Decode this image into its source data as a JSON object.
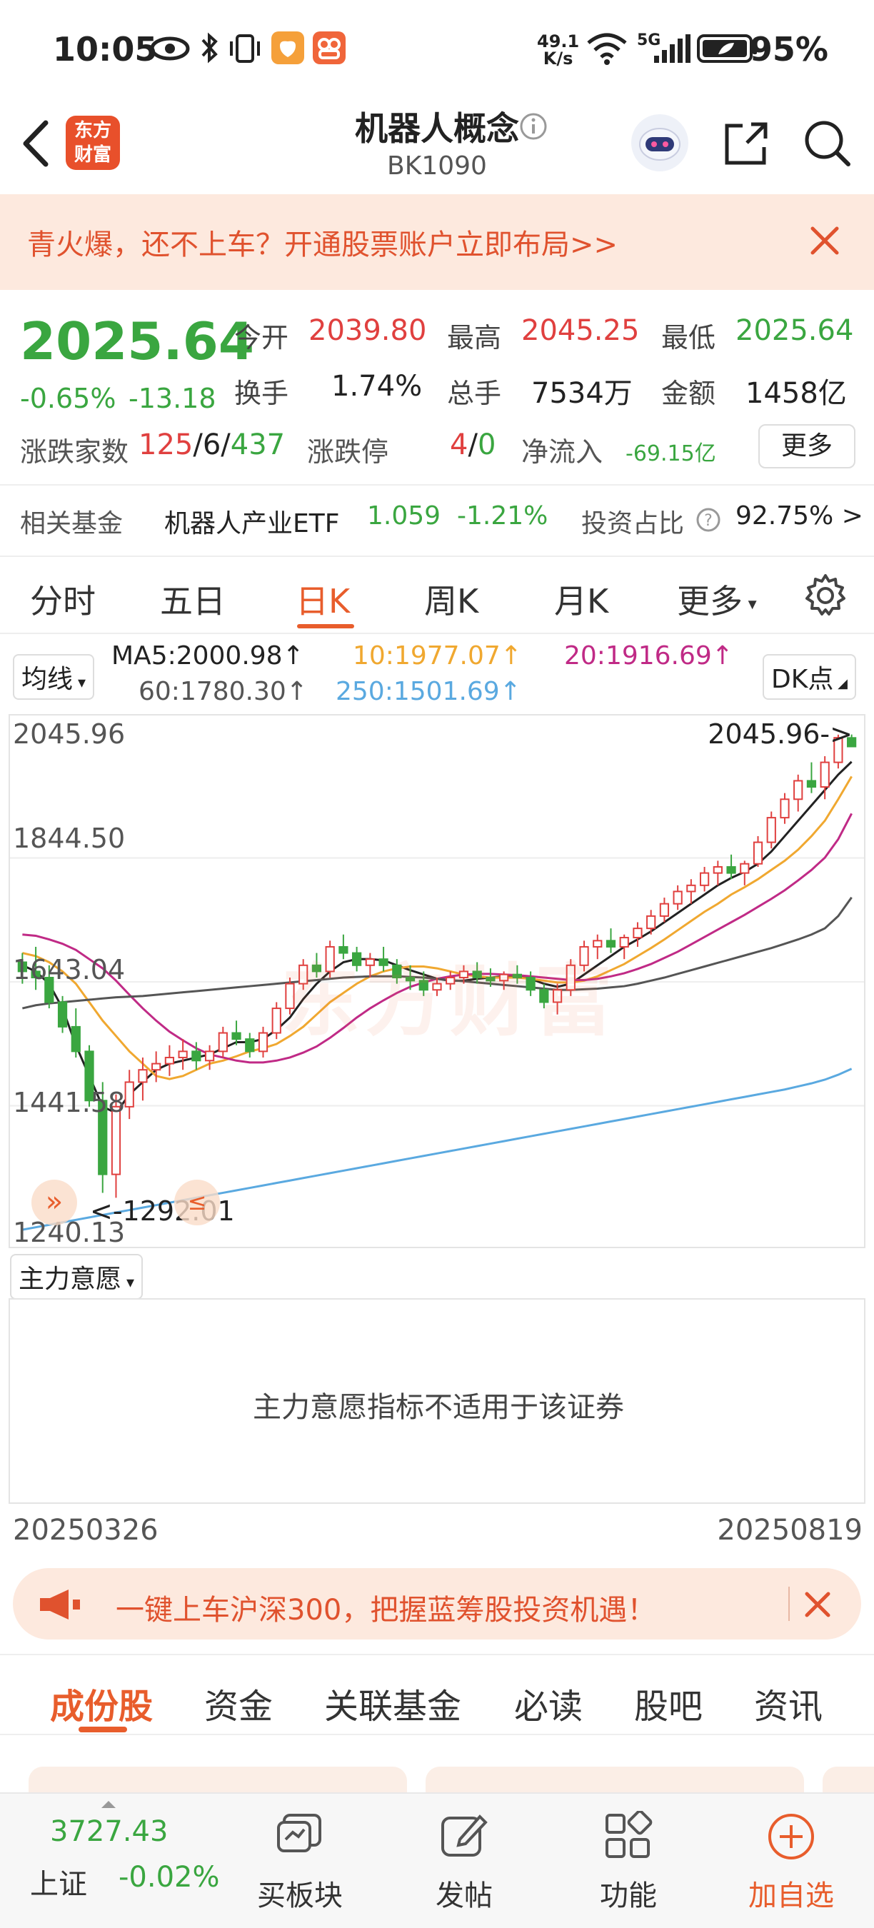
{
  "status_bar": {
    "time": "10:05",
    "net_speed_top": "49.1",
    "net_speed_unit": "K/s",
    "signal": "5G",
    "battery": "95%"
  },
  "header": {
    "title": "机器人概念",
    "code": "BK1090",
    "back_icon": "chevron-left-icon",
    "logo_line1": "东方",
    "logo_line2": "财富"
  },
  "promo": {
    "text": "青火爆，还不上车？开通股票账户立即布局>>"
  },
  "quote": {
    "price": "2025.64",
    "change_pct": "-0.65%",
    "change": "-13.18",
    "open_label": "今开",
    "open": "2039.80",
    "high_label": "最高",
    "high": "2045.25",
    "low_label": "最低",
    "low": "2025.64",
    "turnover_label": "换手",
    "turnover": "1.74%",
    "volume_label": "总手",
    "volume": "7534万",
    "amount_label": "金额",
    "amount": "1458亿",
    "updown_label": "涨跌家数",
    "up_count": "125",
    "flat_count": "6",
    "down_count": "437",
    "limit_label": "涨跌停",
    "limit_up": "4",
    "limit_down": "0",
    "inflow_label": "净流入",
    "inflow": "-69.15亿",
    "more_label": "更多",
    "fund_label": "相关基金",
    "fund_name": "机器人产业ETF",
    "fund_price": "1.059",
    "fund_change": "-1.21%",
    "invest_ratio_label": "投资占比",
    "invest_ratio": "92.75% >"
  },
  "ktabs": [
    "分时",
    "五日",
    "日K",
    "周K",
    "月K",
    "更多"
  ],
  "ktab_active": 2,
  "ma": {
    "selector": "均线",
    "ma5": "MA5:2000.98↑",
    "ma10": "10:1977.07↑",
    "ma20": "20:1916.69↑",
    "ma60": "60:1780.30↑",
    "ma250": "250:1501.69↑",
    "dk": "DK点",
    "colors": {
      "ma5": "#222222",
      "ma10": "#f0a830",
      "ma20": "#c02a86",
      "ma60": "#555555",
      "ma250": "#5aa9e0"
    }
  },
  "chart": {
    "y_labels": [
      "2045.96",
      "1844.50",
      "1643.04",
      "1441.58",
      "1240.13"
    ],
    "high_marker": "2045.96->",
    "low_marker": "<-1292.01",
    "watermark": "东方财富"
  },
  "chart_data": {
    "type": "candlestick",
    "ylim": [
      1240.13,
      2045.96
    ],
    "x_start": "20250326",
    "x_end": "20250819",
    "up_color": "#e0403f",
    "down_color": "#3aa640",
    "ohlc": [
      [
        1675,
        1690,
        1640,
        1660
      ],
      [
        1660,
        1700,
        1630,
        1650
      ],
      [
        1650,
        1670,
        1600,
        1610
      ],
      [
        1610,
        1620,
        1560,
        1570
      ],
      [
        1570,
        1600,
        1520,
        1530
      ],
      [
        1530,
        1540,
        1440,
        1450
      ],
      [
        1450,
        1480,
        1300,
        1330
      ],
      [
        1330,
        1460,
        1292,
        1440
      ],
      [
        1440,
        1500,
        1420,
        1480
      ],
      [
        1480,
        1520,
        1450,
        1500
      ],
      [
        1500,
        1530,
        1480,
        1510
      ],
      [
        1510,
        1540,
        1490,
        1520
      ],
      [
        1520,
        1550,
        1500,
        1530
      ],
      [
        1530,
        1545,
        1500,
        1515
      ],
      [
        1515,
        1540,
        1500,
        1530
      ],
      [
        1530,
        1570,
        1520,
        1560
      ],
      [
        1560,
        1580,
        1540,
        1550
      ],
      [
        1550,
        1560,
        1520,
        1530
      ],
      [
        1530,
        1570,
        1520,
        1560
      ],
      [
        1560,
        1610,
        1550,
        1600
      ],
      [
        1600,
        1650,
        1590,
        1640
      ],
      [
        1640,
        1680,
        1630,
        1670
      ],
      [
        1670,
        1690,
        1650,
        1660
      ],
      [
        1660,
        1710,
        1650,
        1700
      ],
      [
        1700,
        1720,
        1680,
        1690
      ],
      [
        1690,
        1700,
        1660,
        1670
      ],
      [
        1670,
        1690,
        1650,
        1680
      ],
      [
        1680,
        1700,
        1660,
        1670
      ],
      [
        1670,
        1680,
        1640,
        1650
      ],
      [
        1650,
        1670,
        1630,
        1645
      ],
      [
        1645,
        1660,
        1620,
        1630
      ],
      [
        1630,
        1650,
        1620,
        1640
      ],
      [
        1640,
        1660,
        1630,
        1650
      ],
      [
        1650,
        1670,
        1640,
        1660
      ],
      [
        1660,
        1675,
        1640,
        1650
      ],
      [
        1650,
        1665,
        1635,
        1645
      ],
      [
        1645,
        1660,
        1630,
        1655
      ],
      [
        1655,
        1670,
        1640,
        1650
      ],
      [
        1650,
        1660,
        1620,
        1630
      ],
      [
        1630,
        1640,
        1600,
        1610
      ],
      [
        1610,
        1640,
        1590,
        1630
      ],
      [
        1630,
        1680,
        1620,
        1670
      ],
      [
        1670,
        1710,
        1660,
        1700
      ],
      [
        1700,
        1720,
        1680,
        1710
      ],
      [
        1710,
        1730,
        1690,
        1700
      ],
      [
        1700,
        1720,
        1680,
        1715
      ],
      [
        1715,
        1740,
        1700,
        1730
      ],
      [
        1730,
        1760,
        1720,
        1750
      ],
      [
        1750,
        1780,
        1740,
        1770
      ],
      [
        1770,
        1800,
        1760,
        1790
      ],
      [
        1790,
        1810,
        1770,
        1800
      ],
      [
        1800,
        1830,
        1790,
        1820
      ],
      [
        1820,
        1840,
        1800,
        1830
      ],
      [
        1830,
        1850,
        1810,
        1820
      ],
      [
        1820,
        1840,
        1800,
        1835
      ],
      [
        1835,
        1880,
        1830,
        1870
      ],
      [
        1870,
        1920,
        1860,
        1910
      ],
      [
        1910,
        1950,
        1900,
        1940
      ],
      [
        1940,
        1980,
        1920,
        1970
      ],
      [
        1970,
        2000,
        1950,
        1960
      ],
      [
        1960,
        2010,
        1940,
        2000
      ],
      [
        2000,
        2045,
        1990,
        2040
      ],
      [
        2039.8,
        2045.25,
        2025.64,
        2025.64
      ]
    ],
    "ma_lines": {
      "ma5": [
        1670,
        1660,
        1640,
        1600,
        1540,
        1490,
        1440,
        1430,
        1460,
        1480,
        1500,
        1510,
        1515,
        1520,
        1525,
        1535,
        1545,
        1545,
        1550,
        1565,
        1585,
        1615,
        1640,
        1660,
        1675,
        1680,
        1680,
        1678,
        1670,
        1662,
        1655,
        1648,
        1645,
        1645,
        1648,
        1650,
        1652,
        1652,
        1648,
        1640,
        1635,
        1640,
        1655,
        1670,
        1685,
        1700,
        1712,
        1725,
        1740,
        1755,
        1770,
        1785,
        1800,
        1812,
        1822,
        1835,
        1855,
        1880,
        1905,
        1930,
        1955,
        1980,
        2000.98
      ],
      "ma10": [
        1690,
        1685,
        1675,
        1660,
        1640,
        1610,
        1580,
        1555,
        1530,
        1510,
        1490,
        1485,
        1490,
        1500,
        1510,
        1515,
        1522,
        1530,
        1535,
        1542,
        1555,
        1570,
        1590,
        1610,
        1625,
        1640,
        1652,
        1660,
        1665,
        1668,
        1668,
        1665,
        1660,
        1655,
        1652,
        1650,
        1650,
        1650,
        1648,
        1645,
        1642,
        1642,
        1645,
        1652,
        1662,
        1672,
        1685,
        1698,
        1712,
        1727,
        1742,
        1757,
        1770,
        1785,
        1797,
        1810,
        1825,
        1840,
        1858,
        1880,
        1905,
        1940,
        1977.07
      ],
      "ma20": [
        1720,
        1718,
        1712,
        1705,
        1695,
        1680,
        1665,
        1645,
        1622,
        1600,
        1580,
        1562,
        1548,
        1535,
        1525,
        1520,
        1515,
        1512,
        1512,
        1515,
        1520,
        1528,
        1538,
        1552,
        1568,
        1585,
        1600,
        1613,
        1625,
        1635,
        1642,
        1648,
        1652,
        1655,
        1656,
        1656,
        1655,
        1654,
        1652,
        1650,
        1648,
        1646,
        1646,
        1648,
        1652,
        1657,
        1664,
        1672,
        1682,
        1692,
        1704,
        1716,
        1728,
        1740,
        1752,
        1765,
        1778,
        1792,
        1808,
        1825,
        1845,
        1875,
        1916.69
      ],
      "ma60": [
        1600,
        1605,
        1608,
        1610,
        1612,
        1614,
        1616,
        1618,
        1619,
        1620,
        1622,
        1624,
        1626,
        1628,
        1630,
        1632,
        1634,
        1636,
        1638,
        1640,
        1642,
        1644,
        1646,
        1648,
        1650,
        1651,
        1652,
        1652,
        1652,
        1651,
        1650,
        1648,
        1646,
        1644,
        1642,
        1640,
        1638,
        1636,
        1634,
        1632,
        1630,
        1630,
        1631,
        1632,
        1634,
        1636,
        1640,
        1645,
        1650,
        1656,
        1662,
        1668,
        1674,
        1680,
        1686,
        1692,
        1698,
        1705,
        1712,
        1720,
        1730,
        1750,
        1780.3
      ],
      "ma250": [
        1240,
        1244,
        1248,
        1252,
        1256,
        1260,
        1264,
        1268,
        1272,
        1276,
        1280,
        1284,
        1288,
        1292,
        1296,
        1300,
        1304,
        1308,
        1312,
        1316,
        1320,
        1324,
        1328,
        1332,
        1336,
        1340,
        1344,
        1348,
        1352,
        1356,
        1360,
        1364,
        1368,
        1372,
        1376,
        1380,
        1384,
        1388,
        1392,
        1396,
        1400,
        1404,
        1408,
        1412,
        1416,
        1420,
        1424,
        1428,
        1432,
        1436,
        1440,
        1444,
        1448,
        1452,
        1456,
        1460,
        1464,
        1468,
        1473,
        1478,
        1484,
        1492,
        1501.69
      ]
    }
  },
  "indicator": {
    "selector": "主力意愿",
    "message": "主力意愿指标不适用于该证券"
  },
  "dates": {
    "start": "20250326",
    "end": "20250819"
  },
  "promo2": {
    "text": "一键上车沪深300，把握蓝筹股投资机遇！"
  },
  "btabs": [
    "成份股",
    "资金",
    "关联基金",
    "必读",
    "股吧",
    "资讯"
  ],
  "footer": {
    "index_value": "3727.43",
    "index_name": "上证",
    "index_change": "-0.02%",
    "items": [
      {
        "label": "买板块",
        "icon": "plate-icon"
      },
      {
        "label": "发帖",
        "icon": "edit-icon"
      },
      {
        "label": "功能",
        "icon": "grid-icon"
      },
      {
        "label": "加自选",
        "icon": "plus-circle-icon"
      }
    ]
  }
}
